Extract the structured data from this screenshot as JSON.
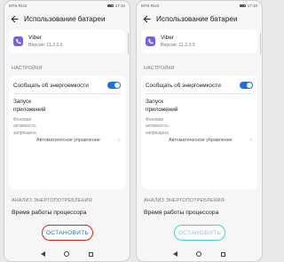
{
  "status_bar": {
    "carrier": "MTS RUS",
    "time": "17:10"
  },
  "header": {
    "title": "Использование батареи"
  },
  "app": {
    "name": "Viber",
    "version": "Версия: 11.2.0.5"
  },
  "settings": {
    "section_label": "НАСТРОЙКИ",
    "notify_label": "Сообщать об энергоемкости",
    "notify_enabled": true,
    "launch_title": "Запуск приложений",
    "launch_sub": "Фоновая активность запрещена",
    "launch_value": "Автоматическое управление"
  },
  "analysis": {
    "section_label": "АНАЛИЗ ЭНЕРГОПОТРЕБЛЕНИЯ",
    "cpu_label": "Время работы процессора"
  },
  "actions": {
    "stop_label": "ОСТАНОВИТЬ"
  },
  "colors": {
    "accent": "#1d6ee0",
    "viber": "#7360f2",
    "highlight_left": "#d9211e",
    "highlight_right": "#47d0c9"
  }
}
